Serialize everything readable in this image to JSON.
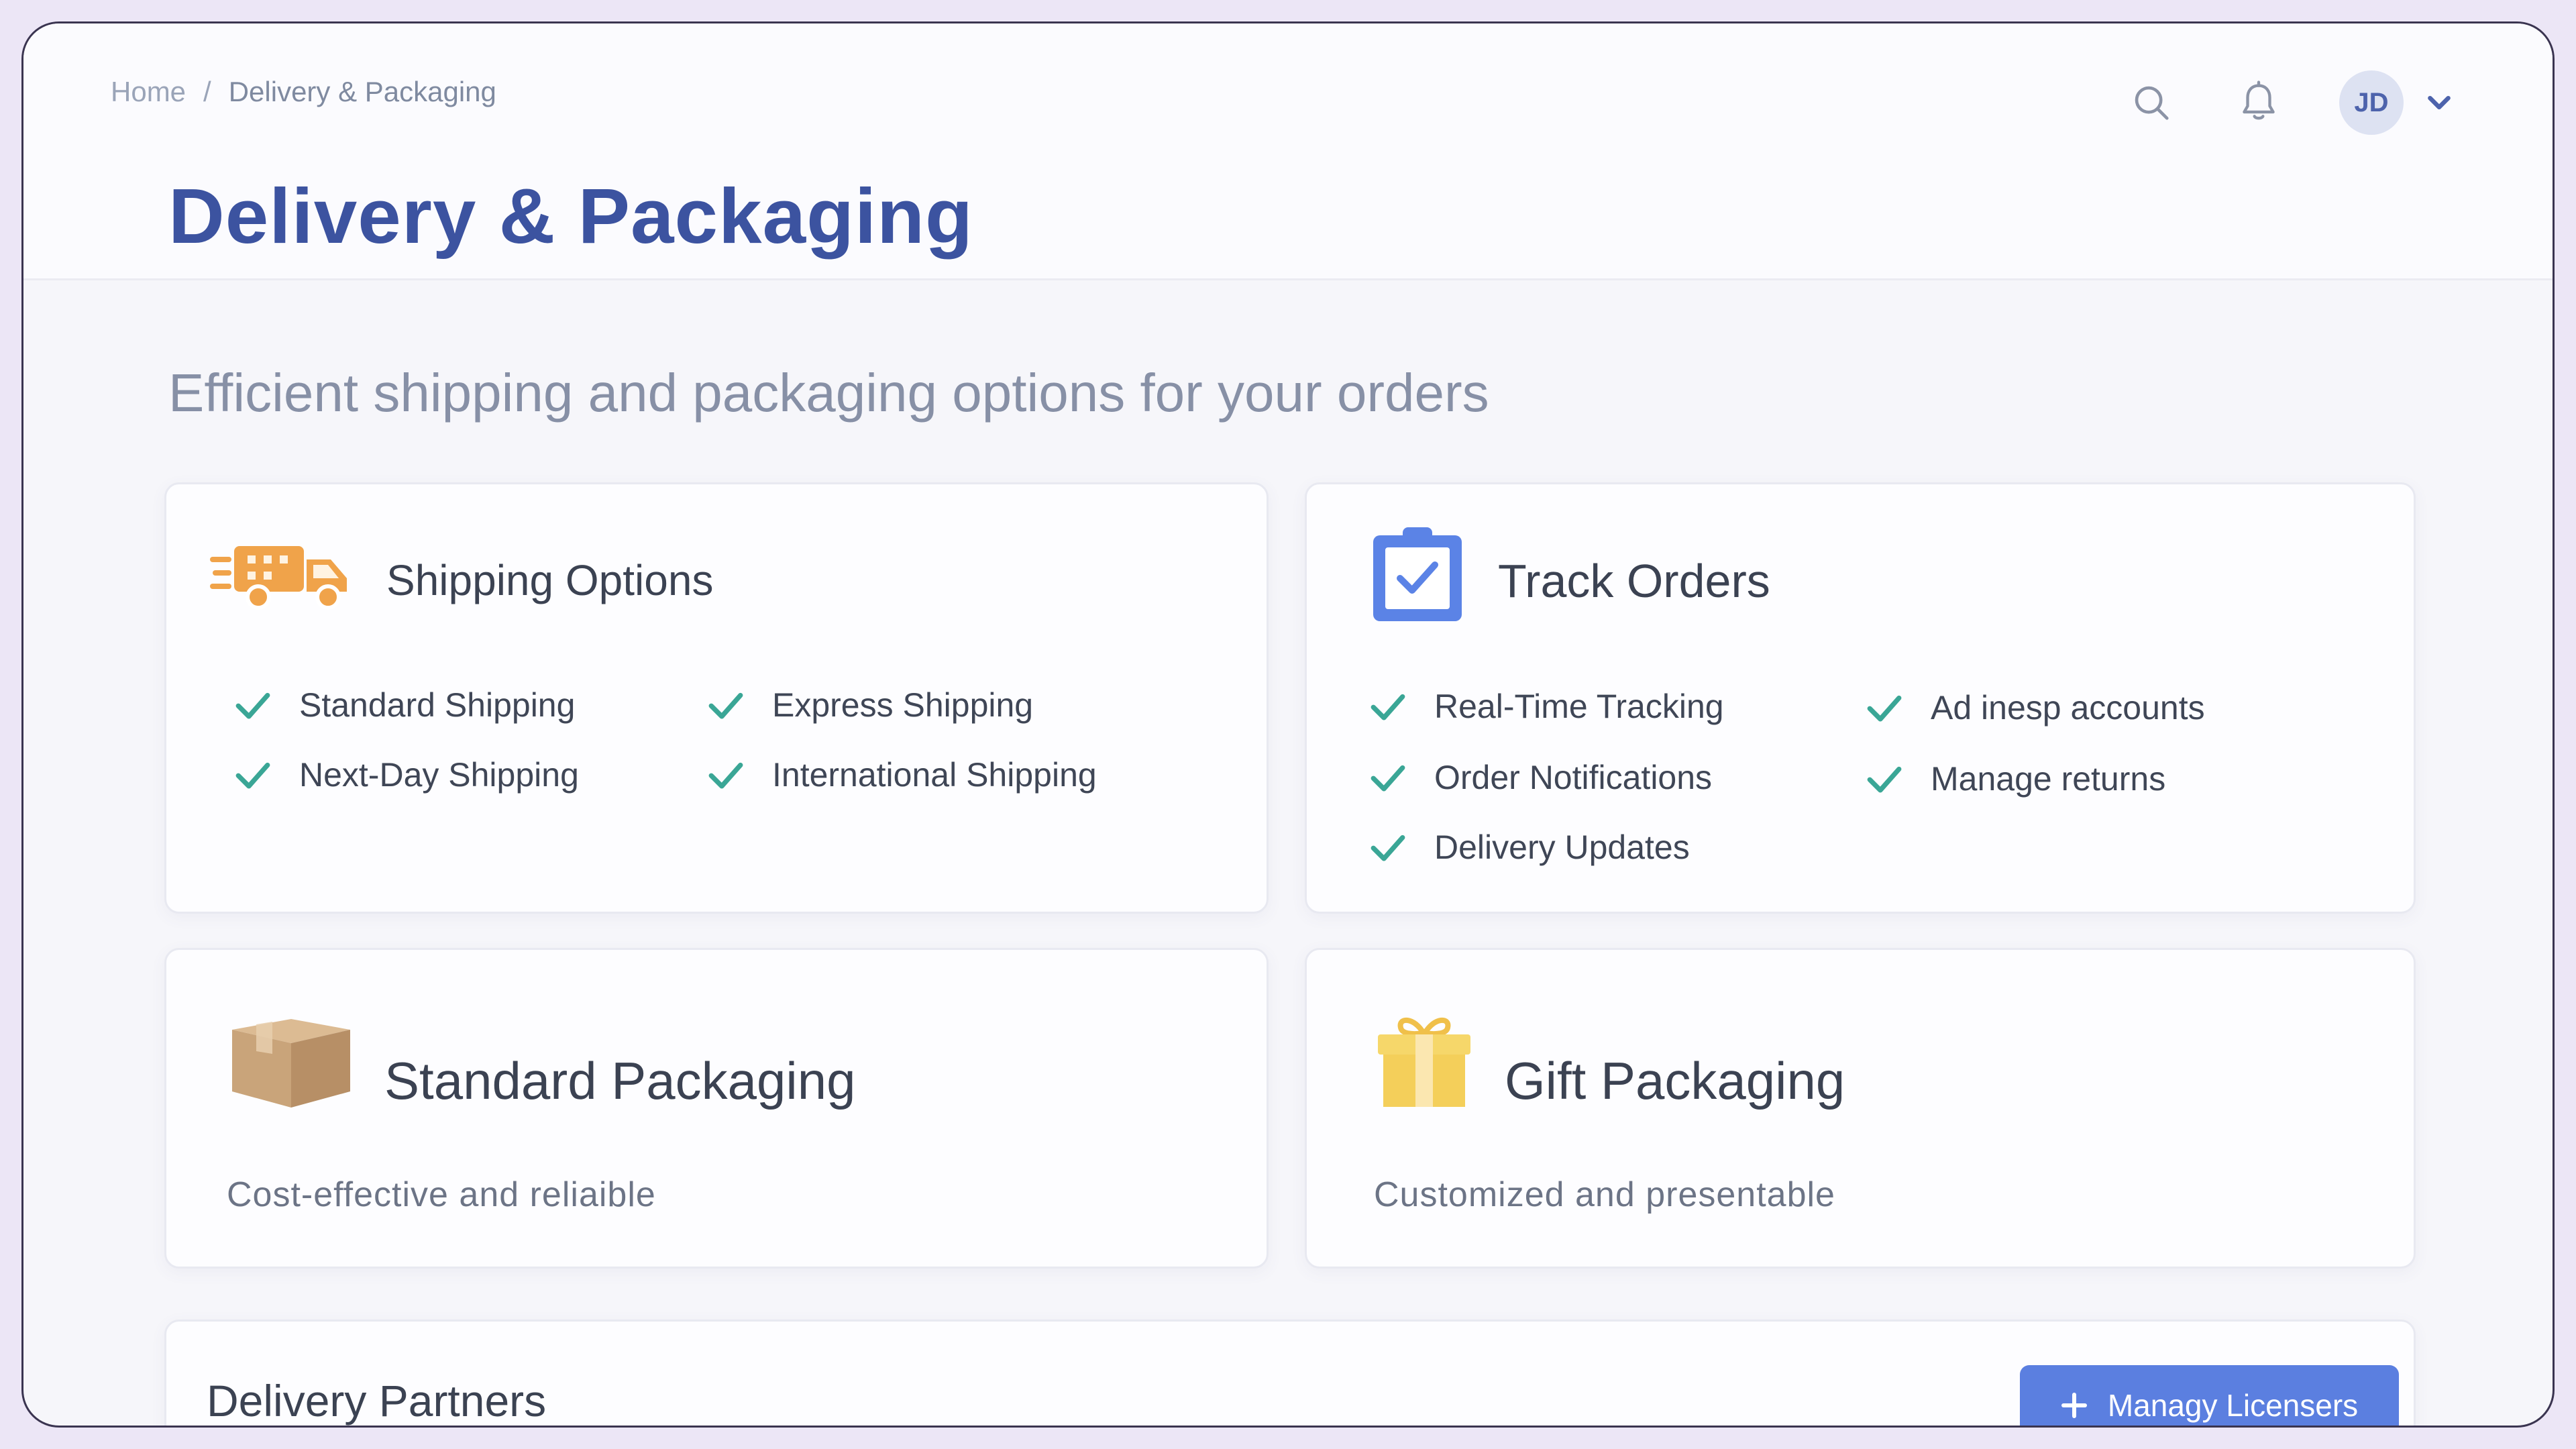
{
  "breadcrumb": {
    "home": "Home",
    "separator": "/",
    "current": "Delivery & Packaging"
  },
  "header": {
    "title": "Delivery & Packaging",
    "avatar_initials": "JD"
  },
  "subtitle": "Efficient shipping and packaging options for your orders",
  "shipping": {
    "title": "Shipping Options",
    "options": [
      "Standard Shipping",
      "Express Shipping",
      "Next-Day Shipping",
      "International Shipping"
    ]
  },
  "tracking": {
    "title": "Track Orders",
    "features": [
      "Real-Time Tracking",
      "Ad inesp accounts",
      "Order Notifications",
      "Manage returns",
      "Delivery Updates"
    ]
  },
  "standard_packaging": {
    "title": "Standard Packaging",
    "description": "Cost-effective and reliaible"
  },
  "gift_packaging": {
    "title": "Gift Packaging",
    "description": "Customized and presentable"
  },
  "partners": {
    "title": "Delivery Partners",
    "button_label": "Managy Licensers"
  },
  "icons": {
    "search": "search-icon",
    "bell": "bell-icon",
    "chevron": "chevron-down-icon",
    "truck": "truck-icon",
    "clipboard": "clipboard-check-icon",
    "box": "box-icon",
    "gift": "gift-icon",
    "check": "check-icon",
    "plus": "plus-icon"
  },
  "colors": {
    "title": "#3c53a0",
    "accent_button": "#5b7fe0",
    "check": "#3aa696",
    "truck": "#f0a34a",
    "clipboard": "#5b83e6",
    "box": "#c9a47a",
    "gift": "#f4cf5a"
  }
}
